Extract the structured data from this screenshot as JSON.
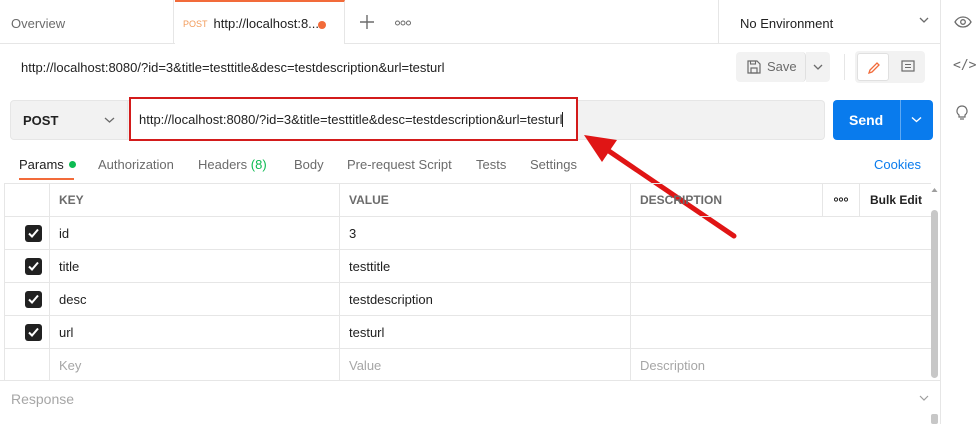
{
  "tabs": {
    "overview_label": "Overview",
    "active": {
      "method": "POST",
      "title": "http://localhost:8..."
    }
  },
  "environment": {
    "label": "No Environment"
  },
  "request": {
    "name": "http://localhost:8080/?id=3&title=testtitle&desc=testdescription&url=testurl",
    "save_label": "Save",
    "method": "POST",
    "url": "http://localhost:8080/?id=3&title=testtitle&desc=testdescription&url=testurl",
    "send_label": "Send"
  },
  "subtabs": {
    "params": "Params",
    "authorization": "Authorization",
    "headers": "Headers",
    "headers_count": "(8)",
    "body": "Body",
    "prerequest": "Pre-request Script",
    "tests": "Tests",
    "settings": "Settings",
    "cookies": "Cookies"
  },
  "params_table": {
    "columns": {
      "key": "KEY",
      "value": "VALUE",
      "description": "DESCRIPTION",
      "more": "ooo",
      "bulk_edit": "Bulk Edit"
    },
    "rows": [
      {
        "key": "id",
        "value": "3",
        "description": "",
        "checked": true
      },
      {
        "key": "title",
        "value": "testtitle",
        "description": "",
        "checked": true
      },
      {
        "key": "desc",
        "value": "testdescription",
        "description": "",
        "checked": true
      },
      {
        "key": "url",
        "value": "testurl",
        "description": "",
        "checked": true
      }
    ],
    "placeholder": {
      "key": "Key",
      "value": "Value",
      "description": "Description"
    }
  },
  "response": {
    "label": "Response"
  },
  "colors": {
    "accent_orange": "#f26b3a",
    "send_blue": "#097bed",
    "highlight_red": "#d31b1b",
    "params_dot_green": "#0cbb52"
  },
  "icons": [
    "plus-icon",
    "more-icon",
    "chevron-down-icon",
    "eye-icon",
    "save-icon",
    "pencil-icon",
    "comment-icon",
    "code-icon",
    "lightbulb-icon",
    "checkbox-check-icon",
    "arrow-annotation"
  ]
}
